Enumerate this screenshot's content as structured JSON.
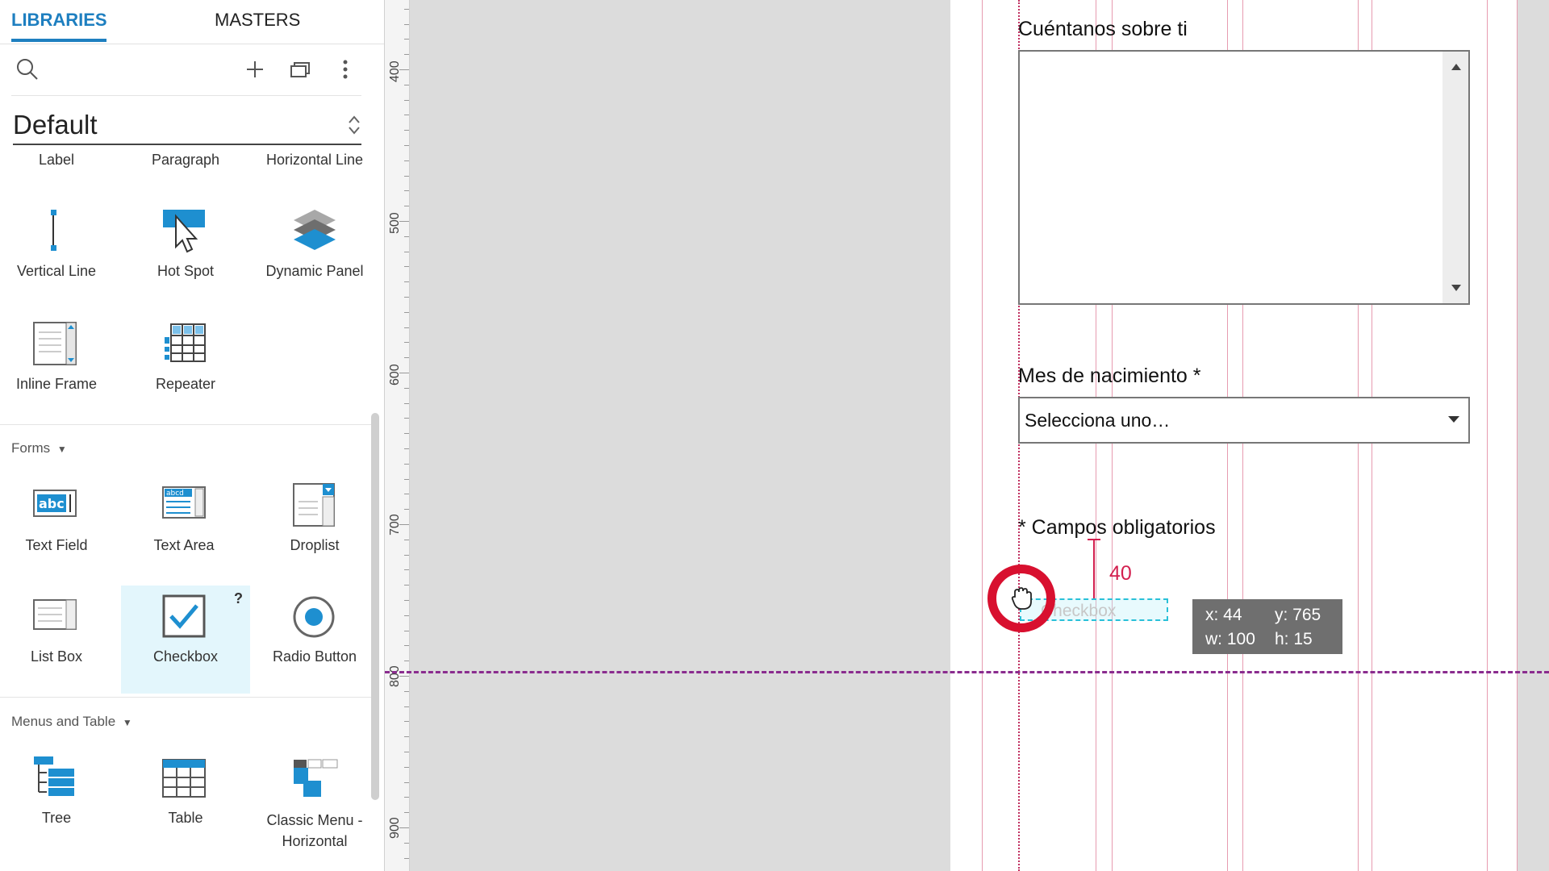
{
  "tabs": [
    {
      "label": "LIBRARIES",
      "active": true
    },
    {
      "label": "MASTERS",
      "active": false
    }
  ],
  "toolbar": {
    "search_icon": "search-icon",
    "add_icon": "plus-icon",
    "copy_icon": "stack-icon",
    "more_icon": "more-vertical-icon"
  },
  "library": {
    "selected": "Default"
  },
  "widgets_top": [
    {
      "label": "Label"
    },
    {
      "label": "Paragraph"
    },
    {
      "label": "Horizontal Line"
    },
    {
      "label": "Vertical Line",
      "icon": "vertical-line-icon"
    },
    {
      "label": "Hot Spot",
      "icon": "hotspot-icon"
    },
    {
      "label": "Dynamic Panel",
      "icon": "dynamic-panel-icon"
    },
    {
      "label": "Inline Frame",
      "icon": "inline-frame-icon"
    },
    {
      "label": "Repeater",
      "icon": "repeater-icon"
    }
  ],
  "sections": {
    "forms": "Forms",
    "menus": "Menus and Table"
  },
  "forms": [
    {
      "label": "Text Field",
      "icon_text": "abc"
    },
    {
      "label": "Text Area",
      "icon_text": "abcd"
    },
    {
      "label": "Droplist"
    },
    {
      "label": "List Box"
    },
    {
      "label": "Checkbox",
      "help": "?"
    },
    {
      "label": "Radio Button"
    }
  ],
  "menus": [
    {
      "label": "Tree"
    },
    {
      "label": "Table"
    },
    {
      "label": "Classic Menu - Horizontal"
    }
  ],
  "ruler": [
    "400",
    "500",
    "600",
    "700",
    "800",
    "900"
  ],
  "canvas": {
    "about_label": "Cuéntanos sobre ti",
    "month_label": "Mes de nacimiento *",
    "month_value": "Selecciona uno…",
    "required_note": "* Campos obligatorios",
    "ghost_checkbox": "Checkbox",
    "spacing": "40",
    "tooltip": {
      "x": "x: 44",
      "y": "y: 765",
      "w": "w: 100",
      "h": "h: 15"
    }
  },
  "colors": {
    "accent": "#1e7fc0",
    "guide": "#e79bb0",
    "spacing": "#d3204f",
    "ring": "#d8102f"
  }
}
